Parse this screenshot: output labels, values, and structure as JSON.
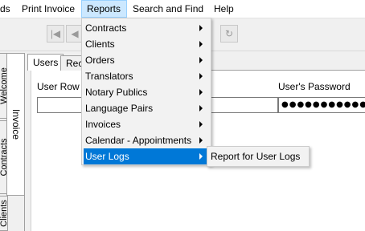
{
  "menubar": {
    "items": [
      {
        "label": "ds"
      },
      {
        "label": "Print Invoice"
      },
      {
        "label": "Reports"
      },
      {
        "label": "Search and Find"
      },
      {
        "label": "Help"
      }
    ]
  },
  "toolbar": {
    "first_icon": "first-record-icon",
    "prev_icon": "previous-record-icon",
    "refresh_icon": "refresh-icon"
  },
  "left_tabs": {
    "welcome": "Welcome",
    "contracts": "Contracts",
    "clients": "Clients",
    "invoice": "Invoice"
  },
  "page_tabs": {
    "users": "Users",
    "records": "Reco"
  },
  "form": {
    "row_label": "User Row N",
    "password_label": "User's Password",
    "password_value": "●●●●●●●●●●●●●●●●"
  },
  "reports_menu": {
    "items": [
      {
        "label": "Contracts"
      },
      {
        "label": "Clients"
      },
      {
        "label": "Orders"
      },
      {
        "label": "Translators"
      },
      {
        "label": "Notary Publics"
      },
      {
        "label": "Language Pairs"
      },
      {
        "label": "Invoices"
      },
      {
        "label": "Calendar - Appointments"
      },
      {
        "label": "User Logs"
      }
    ]
  },
  "user_logs_submenu": {
    "items": [
      {
        "label": "Report for User Logs"
      }
    ]
  },
  "colors": {
    "highlight": "#0078d7",
    "menu_active": "#cce8ff"
  }
}
